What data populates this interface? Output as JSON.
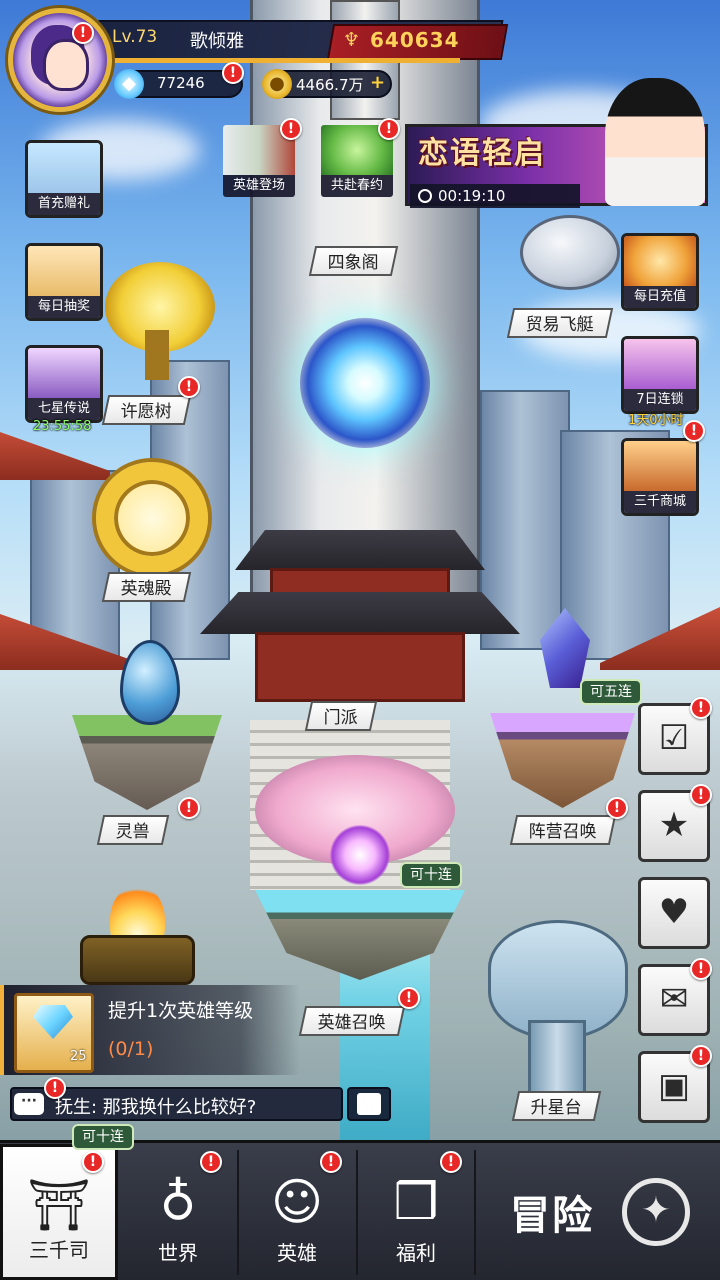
{
  "player": {
    "level": "Lv.73",
    "name": "歌倾雅",
    "power": "640634",
    "diamonds": "77246",
    "gold": "4466.7万"
  },
  "icons": {
    "power": "crest-icon",
    "diamond": "diamond-icon",
    "gold": "coin-icon",
    "clock": "clock-icon",
    "chat": "chat-icon",
    "emoji": "emoji-face-icon"
  },
  "left_events": [
    {
      "label": "首充赠礼"
    },
    {
      "label": "每日抽奖"
    },
    {
      "label": "七星传说",
      "timer": "23:55:58"
    }
  ],
  "top_events": [
    {
      "label": "英雄登场"
    },
    {
      "label": "共赴春约"
    }
  ],
  "banner": {
    "title": "恋语轻启",
    "timer": "00:19:10"
  },
  "right_events": [
    {
      "label": "每日充值"
    },
    {
      "label": "7日连锁",
      "timer": "1天0小时"
    },
    {
      "label": "三千商城"
    }
  ],
  "places": {
    "sixiang": "四象阁",
    "trade_airship": "贸易飞艇",
    "wish_tree": "许愿树",
    "hero_soul": "英魂殿",
    "sect": "门派",
    "spirit_beast": "灵兽",
    "camp_summon": "阵营召唤",
    "hero_summon": "英雄召唤",
    "star_up": "升星台"
  },
  "bubbles": {
    "camp_summon": "可五连",
    "hero_summon": "可十连",
    "nav_home": "可十连"
  },
  "quest": {
    "title": "提升1次英雄等级",
    "progress": "(0/1)",
    "reward_count": "25"
  },
  "chat": {
    "text": "抚生: 那我换什么比较好?"
  },
  "nav": {
    "home": "三千司",
    "world": "世界",
    "heroes": "英雄",
    "welfare": "福利",
    "adventure": "冒险"
  },
  "badge_mark": "!",
  "colors": {
    "badge": "#e82727",
    "gold_text": "#ffd25c",
    "progress_text": "#ff8a48",
    "timer_green": "#8cff6a"
  }
}
